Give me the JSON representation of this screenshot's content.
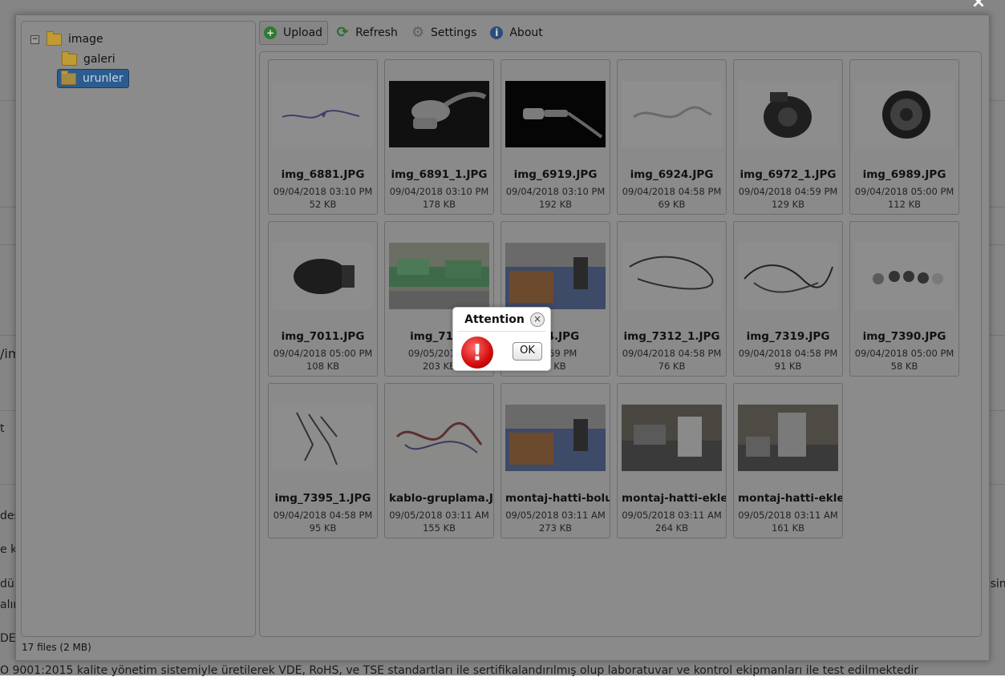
{
  "background": {
    "texts": [
      "/im",
      "t",
      "deş",
      "e ka",
      "dür",
      "alın",
      "DE",
      "esin",
      "O 9001:2015 kalite yönetim sistemiyle üretilerek VDE, RoHS, ve TSE standartları ile sertifikalandırılmış olup laboratuvar ve kontrol ekipmanları ile test edilmektedir"
    ]
  },
  "close_icon": "×",
  "tree": {
    "collapse_symbol": "−",
    "root": "image",
    "children": [
      "galeri",
      "urunler"
    ],
    "selected": "urunler"
  },
  "toolbar": {
    "upload": "Upload",
    "refresh": "Refresh",
    "settings": "Settings",
    "about": "About",
    "refresh_glyph": "⟳",
    "settings_glyph": "⚙",
    "about_glyph": "i",
    "upload_glyph": "+"
  },
  "files": [
    {
      "name": "img_6881.JPG",
      "date": "09/04/2018 03:10 PM",
      "size": "52 KB"
    },
    {
      "name": "img_6891_1.JPG",
      "date": "09/04/2018 03:10 PM",
      "size": "178 KB"
    },
    {
      "name": "img_6919.JPG",
      "date": "09/04/2018 03:10 PM",
      "size": "192 KB"
    },
    {
      "name": "img_6924.JPG",
      "date": "09/04/2018 04:58 PM",
      "size": "69 KB"
    },
    {
      "name": "img_6972_1.JPG",
      "date": "09/04/2018 04:59 PM",
      "size": "129 KB"
    },
    {
      "name": "img_6989.JPG",
      "date": "09/04/2018 05:00 PM",
      "size": "112 KB"
    },
    {
      "name": "img_7011.JPG",
      "date": "09/04/2018 05:00 PM",
      "size": "108 KB"
    },
    {
      "name": "img_7142",
      "date": "09/05/2018 0",
      "size": "203 KB"
    },
    {
      "name": "254.JPG",
      "date": "04:59 PM",
      "size": "6 KB"
    },
    {
      "name": "img_7312_1.JPG",
      "date": "09/04/2018 04:58 PM",
      "size": "76 KB"
    },
    {
      "name": "img_7319.JPG",
      "date": "09/04/2018 04:58 PM",
      "size": "91 KB"
    },
    {
      "name": "img_7390.JPG",
      "date": "09/04/2018 05:00 PM",
      "size": "58 KB"
    },
    {
      "name": "img_7395_1.JPG",
      "date": "09/04/2018 04:58 PM",
      "size": "95 KB"
    },
    {
      "name": "kablo-gruplama.JI",
      "date": "09/05/2018 03:11 AM",
      "size": "155 KB"
    },
    {
      "name": "montaj-hatti-bolu",
      "date": "09/05/2018 03:11 AM",
      "size": "273 KB"
    },
    {
      "name": "montaj-hatti-ekle-",
      "date": "09/05/2018 03:11 AM",
      "size": "264 KB"
    },
    {
      "name": "montaj-hatti-ekle.",
      "date": "09/05/2018 03:11 AM",
      "size": "161 KB"
    }
  ],
  "status": "17 files (2 MB)",
  "dialog": {
    "title": "Attention",
    "close_glyph": "×",
    "icon_glyph": "!",
    "ok": "OK"
  }
}
